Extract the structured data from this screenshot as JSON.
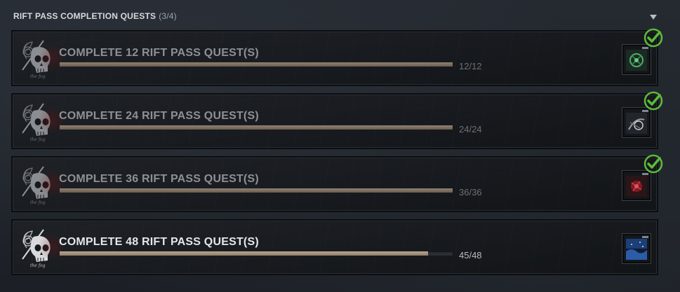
{
  "section": {
    "title": "RIFT PASS COMPLETION QUESTS",
    "count": "(3/4)",
    "toggle_icon": "triangle-down-icon"
  },
  "quests": [
    {
      "title": "COMPLETE 12 RIFT PASS QUEST(S)",
      "progress_text": "12/12",
      "progress": 1.0,
      "completed": true,
      "reward_icon": "reward-green-charm-icon"
    },
    {
      "title": "COMPLETE 24 RIFT PASS QUEST(S)",
      "progress_text": "24/24",
      "progress": 1.0,
      "completed": true,
      "reward_icon": "reward-grey-charm-icon"
    },
    {
      "title": "COMPLETE 36 RIFT PASS QUEST(S)",
      "progress_text": "36/36",
      "progress": 1.0,
      "completed": true,
      "reward_icon": "reward-red-charm-icon"
    },
    {
      "title": "COMPLETE 48 RIFT PASS QUEST(S)",
      "progress_text": "45/48",
      "progress": 0.9375,
      "completed": false,
      "reward_icon": "reward-blue-banner-icon"
    }
  ],
  "colors": {
    "check": "#5dbb3a",
    "progress_fill": "#b9a68f"
  }
}
